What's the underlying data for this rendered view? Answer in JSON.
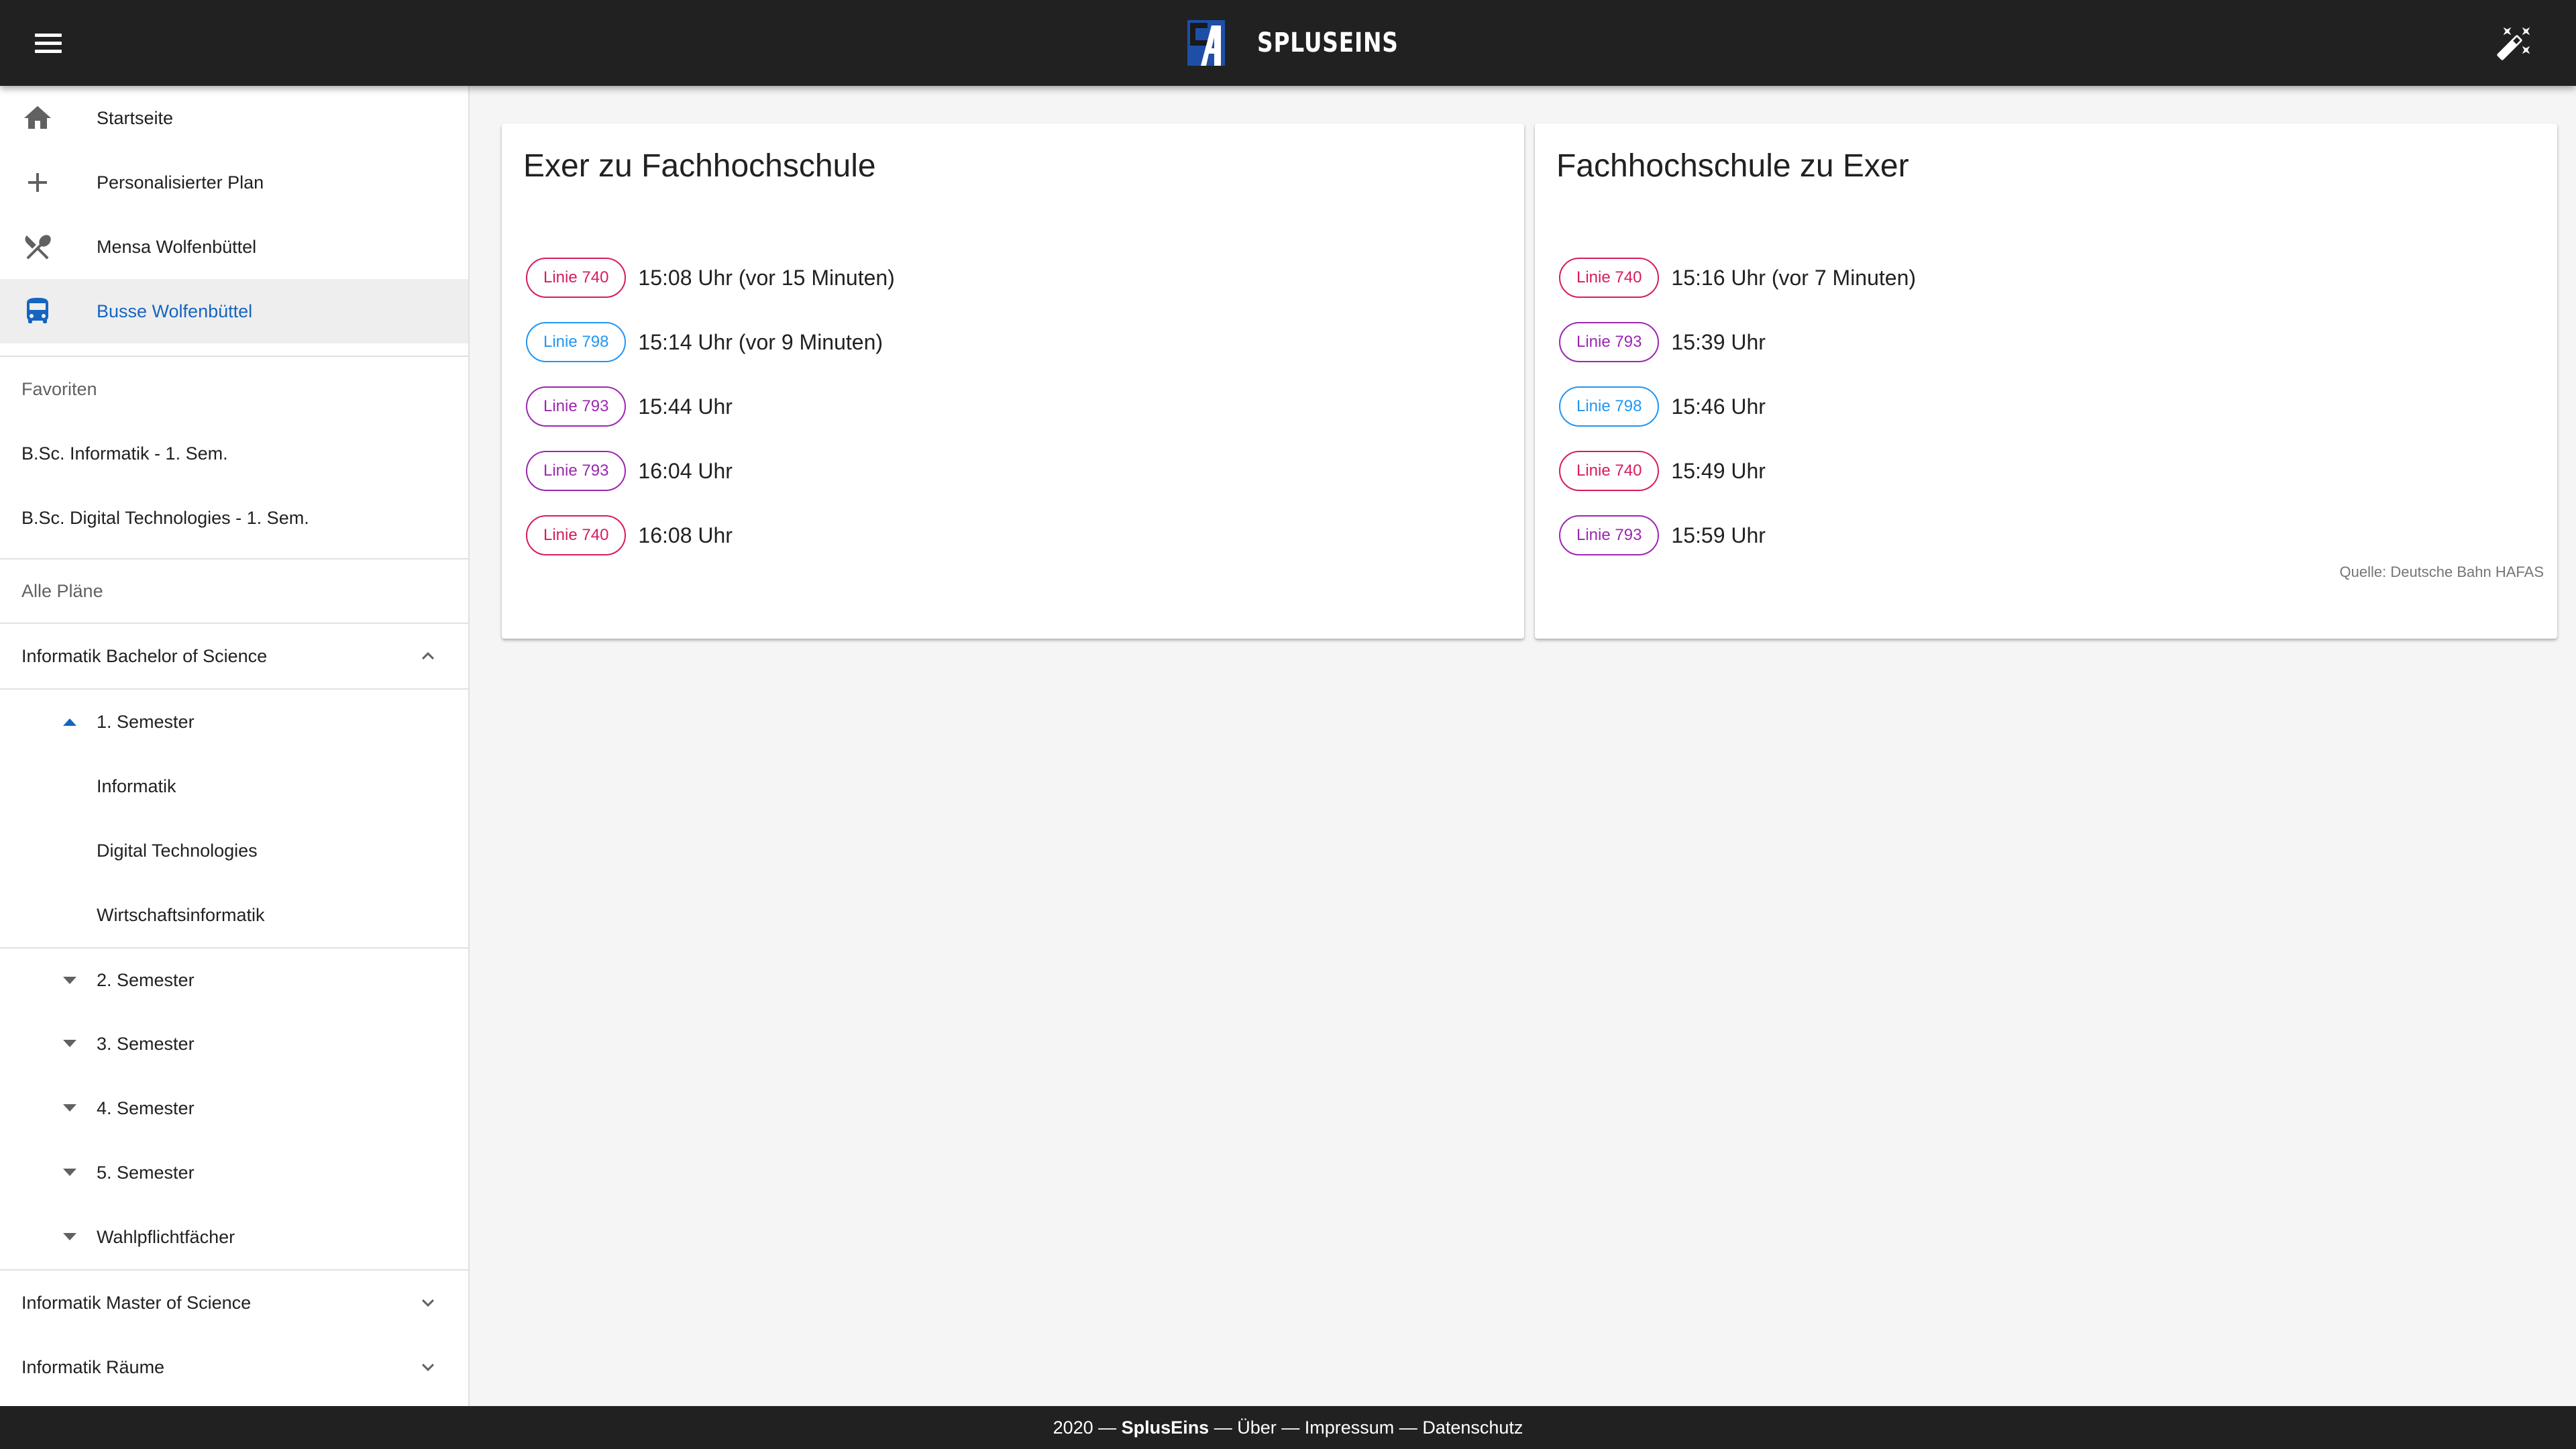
{
  "header": {
    "brand_name": "SPLUSEINS",
    "menu_icon": "menu-icon",
    "theme_icon": "theme-toggle-icon"
  },
  "sidebar": {
    "nav": [
      {
        "label": "Startseite",
        "icon": "home-icon"
      },
      {
        "label": "Personalisierter Plan",
        "icon": "plus-icon"
      },
      {
        "label": "Mensa Wolfenbüttel",
        "icon": "utensils-icon"
      },
      {
        "label": "Busse Wolfenbüttel",
        "icon": "bus-icon",
        "active": true
      }
    ],
    "favorites_header": "Favoriten",
    "favorites": [
      "B.Sc. Informatik - 1. Sem.",
      "B.Sc. Digital Technologies - 1. Sem."
    ],
    "all_plans_header": "Alle Pläne",
    "groups": [
      {
        "label": "Informatik Bachelor of Science",
        "expanded": true
      },
      {
        "label": "Informatik Master of Science",
        "expanded": false
      },
      {
        "label": "Informatik Räume",
        "expanded": false
      }
    ],
    "semesters": [
      {
        "label": "1. Semester",
        "expanded": true
      },
      {
        "label": "2. Semester"
      },
      {
        "label": "3. Semester"
      },
      {
        "label": "4. Semester"
      },
      {
        "label": "5. Semester"
      },
      {
        "label": "Wahlpflichtfächer"
      }
    ],
    "sem1_items": [
      "Informatik",
      "Digital Technologies",
      "Wirtschaftsinformatik"
    ]
  },
  "main": {
    "colors": {
      "740": "#d81b60",
      "798": "#2196f3",
      "793": "#9c27b0"
    },
    "cards": [
      {
        "title": "Exer zu Fachhochschule",
        "departures": [
          {
            "line": "Linie 740",
            "line_id": "740",
            "time": "15:08 Uhr (vor 15 Minuten)"
          },
          {
            "line": "Linie 798",
            "line_id": "798",
            "time": "15:14 Uhr (vor 9 Minuten)"
          },
          {
            "line": "Linie 793",
            "line_id": "793",
            "time": "15:44 Uhr"
          },
          {
            "line": "Linie 793",
            "line_id": "793",
            "time": "16:04 Uhr"
          },
          {
            "line": "Linie 740",
            "line_id": "740",
            "time": "16:08 Uhr"
          }
        ]
      },
      {
        "title": "Fachhochschule zu Exer",
        "departures": [
          {
            "line": "Linie 740",
            "line_id": "740",
            "time": "15:16 Uhr (vor 7 Minuten)"
          },
          {
            "line": "Linie 793",
            "line_id": "793",
            "time": "15:39 Uhr"
          },
          {
            "line": "Linie 798",
            "line_id": "798",
            "time": "15:46 Uhr"
          },
          {
            "line": "Linie 740",
            "line_id": "740",
            "time": "15:49 Uhr"
          },
          {
            "line": "Linie 793",
            "line_id": "793",
            "time": "15:59 Uhr"
          }
        ]
      }
    ],
    "source": "Quelle: Deutsche Bahn HAFAS"
  },
  "footer": {
    "year": "2020",
    "sep": " — ",
    "brand": "SplusEins",
    "about": "Über",
    "imprint": "Impressum",
    "privacy": "Datenschutz"
  }
}
